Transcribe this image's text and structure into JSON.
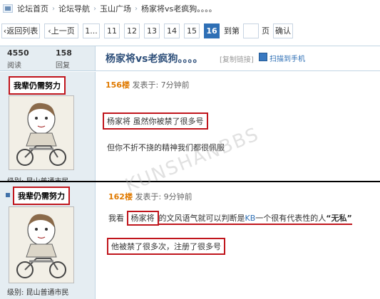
{
  "breadcrumb": {
    "items": [
      "论坛首页",
      "论坛导航",
      "玉山广场",
      "杨家将vs老疯狗。。。。"
    ]
  },
  "pager": {
    "back_label": "返回列表",
    "prev_label": "上一页",
    "first_label": "1...",
    "pages": [
      "11",
      "12",
      "13",
      "14",
      "15",
      "16"
    ],
    "current_page": "16",
    "goto_label": "到第",
    "page_unit": "页",
    "confirm_label": "确认",
    "goto_value": ""
  },
  "thread": {
    "views": "4550",
    "views_label": "阅读",
    "replies": "158",
    "replies_label": "回复",
    "title": "杨家将vs老疯狗。。。。",
    "copy_link": "[复制链接]",
    "qr_label": "扫描到手机"
  },
  "posts": [
    {
      "username": "我辈仍需努力",
      "floor": "156楼",
      "time": "发表于: 7分钟前",
      "level": "级别: 昆山普通市民",
      "line1": "杨家将    虽然你被禁了很多号",
      "line2": "但你不折不挠的精神我们都很佩服"
    },
    {
      "username": "我辈仍需努力",
      "floor": "162楼",
      "time": "发表于: 9分钟前",
      "level": "级别: 昆山普通市民",
      "line1_prefix": "我看",
      "line1_name": "杨家将",
      "line1_mid": "的文风语气就可以判断是",
      "line1_kb": "KB",
      "line1_rest": "一个很有代表性的人",
      "line1_quote": "“无私”",
      "line2": "他被禁了很多次，注册了很多号"
    }
  ],
  "watermark": "KUNSHANBBS",
  "colors": {
    "accent": "#2e6fb5",
    "highlight": "#c0151c",
    "sidebar": "#e5edf2"
  }
}
